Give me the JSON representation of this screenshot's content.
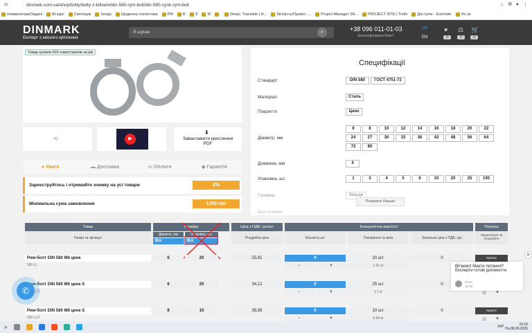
{
  "browser": {
    "url": "dinmark.com.ua/shop/bolty/bolty-z-kiltsem/din-580-rym-bolt/din-580-cynk-rym-bolt",
    "bookmarks": [
      "ілюминатори/Задачі",
      "AI курс",
      "Синтезум",
      "Songs",
      "Щоденна статистика",
      "PM",
      "R",
      "S",
      "M",
      "",
      "DeepL Translate | Н...",
      "Зв'язість/Провісі -...",
      "Project Manager SR...",
      "PROJECT SITE | Trello",
      "Доступні - Evernote",
      "Усі за"
    ]
  },
  "header": {
    "logo": "DINMARK",
    "tagline": "Експерт з якісного кріплення",
    "search_placeholder": "Я шукаю",
    "phone": "+38 096 011-01-03",
    "callback": "Зателефонувати Вам?",
    "lang_ua": "UA",
    "lang_en": "EN",
    "counts": [
      "0",
      "0",
      "0"
    ]
  },
  "product": {
    "badge": "Товар купили 502 користувачів за рік",
    "download_label": "Завантажити креслення PDF"
  },
  "specs": {
    "title": "Специфікації",
    "labels": {
      "standard": "Стандарт",
      "material": "Матеріал",
      "coating": "Покриття",
      "diameter": "Діаметр, мм",
      "length": "Довжина, мм",
      "pack": "Упаковка, шт.",
      "head": "Головка",
      "more_label": "Без головки"
    },
    "standard": [
      "DIN 580",
      "ГОСТ 4751-73"
    ],
    "material": "Сталь",
    "coating": "Цинк",
    "diameters": [
      "6",
      "8",
      "10",
      "12",
      "14",
      "16",
      "18",
      "20",
      "22",
      "24",
      "27",
      "30",
      "33",
      "36",
      "42",
      "48",
      "56",
      "64",
      "72",
      "80"
    ],
    "length": "4",
    "pack": [
      "1",
      "3",
      "4",
      "5",
      "6",
      "10",
      "20",
      "25",
      "100"
    ],
    "head_value": "Кільце",
    "show_more": "Показати більше"
  },
  "tabs": [
    "Увага",
    "Доставка",
    "Оплати",
    "Гарантія"
  ],
  "info": [
    {
      "text": "Зареєструйтесь і отримайте знижку на усі товари",
      "value": "2%"
    },
    {
      "text": "Мінімальна сума замовлення",
      "value": "1200 грн"
    }
  ],
  "table": {
    "h_product": "Товар",
    "h_sizes": "Розміри",
    "h_price": "Ціна з ПДВ, грн/шт",
    "h_calc": "Калькулятор вартості",
    "h_buy": "Покупка",
    "sub": {
      "name": "Назва та артикул",
      "diam": "Діаметр, мм",
      "thread": "Упаковка, шт.",
      "price": "Роздрібна ціна",
      "qty": "Кількість,шт",
      "pack": "Пакування та вага",
      "total": "Загальна ціна з ПДВ, грн",
      "buy": "Підписатися чи оподобати"
    },
    "filter_all": "Всі",
    "rows": [
      {
        "name": "Рим-болт DIN 580 M6 цинк",
        "sku": "580-Ц",
        "d": "6",
        "l": "20",
        "price": "25,61",
        "qty": "0",
        "pack": "20 шт.",
        "weight": "1.01 кг",
        "total": "0",
        "buy": "Купити"
      },
      {
        "name": "Рим-болт DIN 580 M6 цинк S",
        "sku": "580-Ц S",
        "d": "6",
        "l": "25",
        "price": "34,12",
        "qty": "0",
        "pack": "25 шт.",
        "weight": "1.7 кг",
        "total": "0",
        "buy": "Купити"
      },
      {
        "name": "Рим-болт DIN 580 M8 цинк S",
        "sku": "580-Ц 8",
        "d": "8",
        "l": "10",
        "price": "35,58",
        "qty": "0",
        "pack": "10 шт.",
        "weight": "0.54 кг",
        "total": "0",
        "buy": "Купити"
      }
    ]
  },
  "chat": {
    "text": "Вітаємо! Маєте питання? Експерти готові допомогти.",
    "agent": "Поля",
    "time": "15:08"
  },
  "taskbar": {
    "lang": "УКР",
    "time": "10:10",
    "date": "Пн,08.09.2025"
  }
}
